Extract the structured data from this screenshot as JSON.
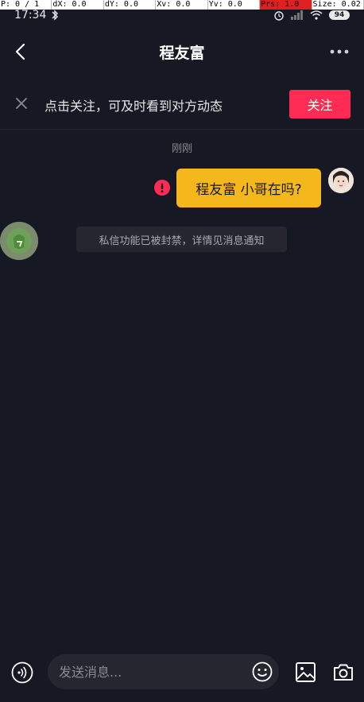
{
  "debug_bar": {
    "p": "P: 0 / 1",
    "dx": "dX: 0.0",
    "dy": "dY: 0.0",
    "xv": "Xv: 0.0",
    "yv": "Yv: 0.0",
    "prs": "Prs: 1.0",
    "size": "Size: 0.02"
  },
  "status_bar": {
    "time": "17:34",
    "battery": "94"
  },
  "header": {
    "title": "程友富"
  },
  "follow_banner": {
    "text": "点击关注，可及时看到对方动态",
    "button_label": "关注"
  },
  "chat": {
    "timestamp": "刚刚",
    "messages": [
      {
        "direction": "outgoing",
        "text": "程友富 小哥在吗?",
        "status": "failed"
      }
    ],
    "system_notice": "私信功能已被封禁，详情见消息通知"
  },
  "input_bar": {
    "placeholder": "发送消息..."
  },
  "colors": {
    "background": "#161823",
    "accent": "#fe2c55",
    "bubble": "#f5b81c",
    "notice_bg": "#25262f"
  },
  "icons": [
    "back-icon",
    "more-icon",
    "close-icon",
    "error-icon",
    "voice-icon",
    "emoji-icon",
    "image-icon",
    "camera-icon"
  ]
}
